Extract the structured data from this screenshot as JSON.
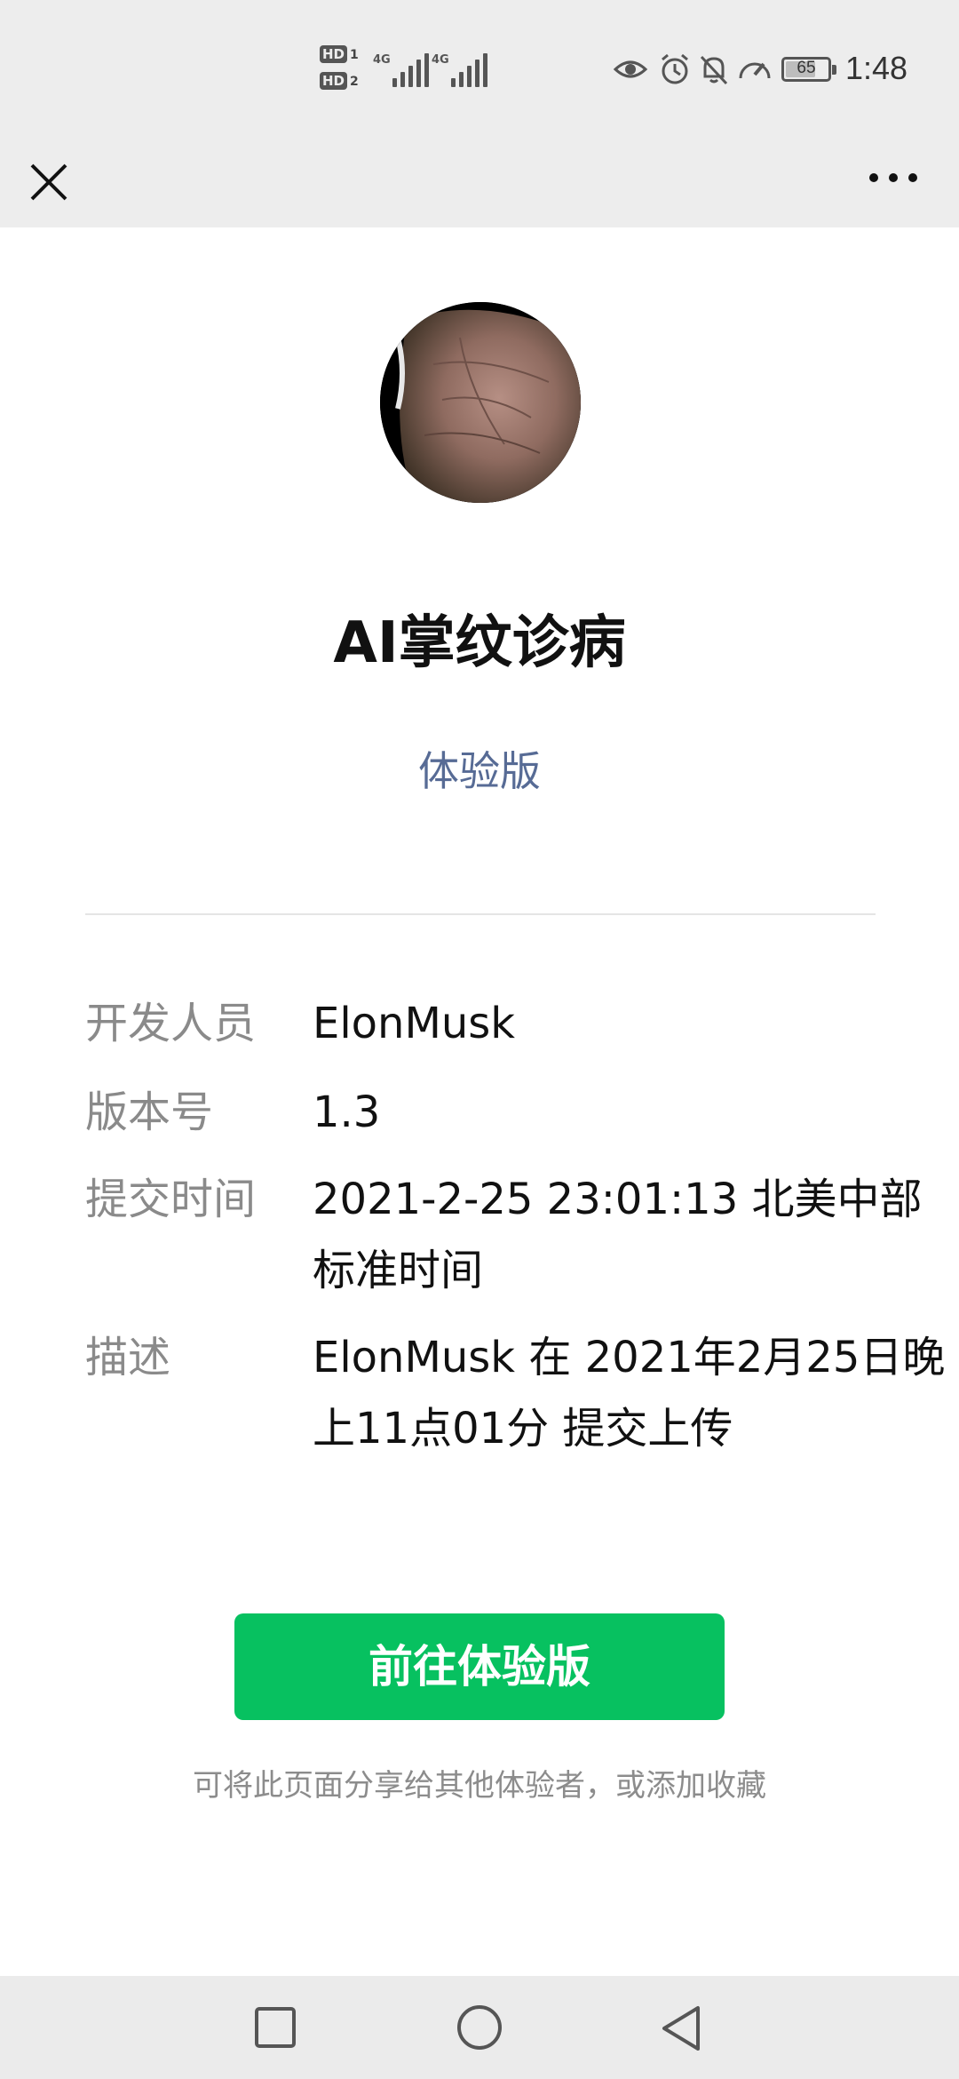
{
  "status_bar": {
    "time": "1:48",
    "battery": "65",
    "battery_level": 0.65,
    "sim1_label": "HD",
    "sim1_index": "1",
    "sim2_label": "HD",
    "sim2_index": "2",
    "network1": "4G",
    "network2": "4G",
    "icons": [
      "eye-icon",
      "alarm-icon",
      "mute-bell-icon",
      "speed-gauge-icon"
    ]
  },
  "nav": {
    "close_icon": "close-icon",
    "more_icon": "more-dots-icon"
  },
  "app": {
    "name": "AI掌纹诊病",
    "version_type": "体验版"
  },
  "info": [
    {
      "label": "开发人员",
      "value": "ElonMusk"
    },
    {
      "label": "版本号",
      "value": "1.3"
    },
    {
      "label": "提交时间",
      "value": "2021-2-25 23:01:13 北美中部标准时间"
    },
    {
      "label": "描述",
      "value": "ElonMusk 在 2021年2月25日晚上11点01分 提交上传"
    }
  ],
  "primary_button": "前往体验版",
  "hint": "可将此页面分享给其他体验者，或添加收藏",
  "colors": {
    "accent_green": "#07c160",
    "link_blue": "#576b95",
    "bar_gray": "#ededed"
  },
  "system_nav": [
    "recents-square-icon",
    "home-circle-icon",
    "back-triangle-icon"
  ]
}
